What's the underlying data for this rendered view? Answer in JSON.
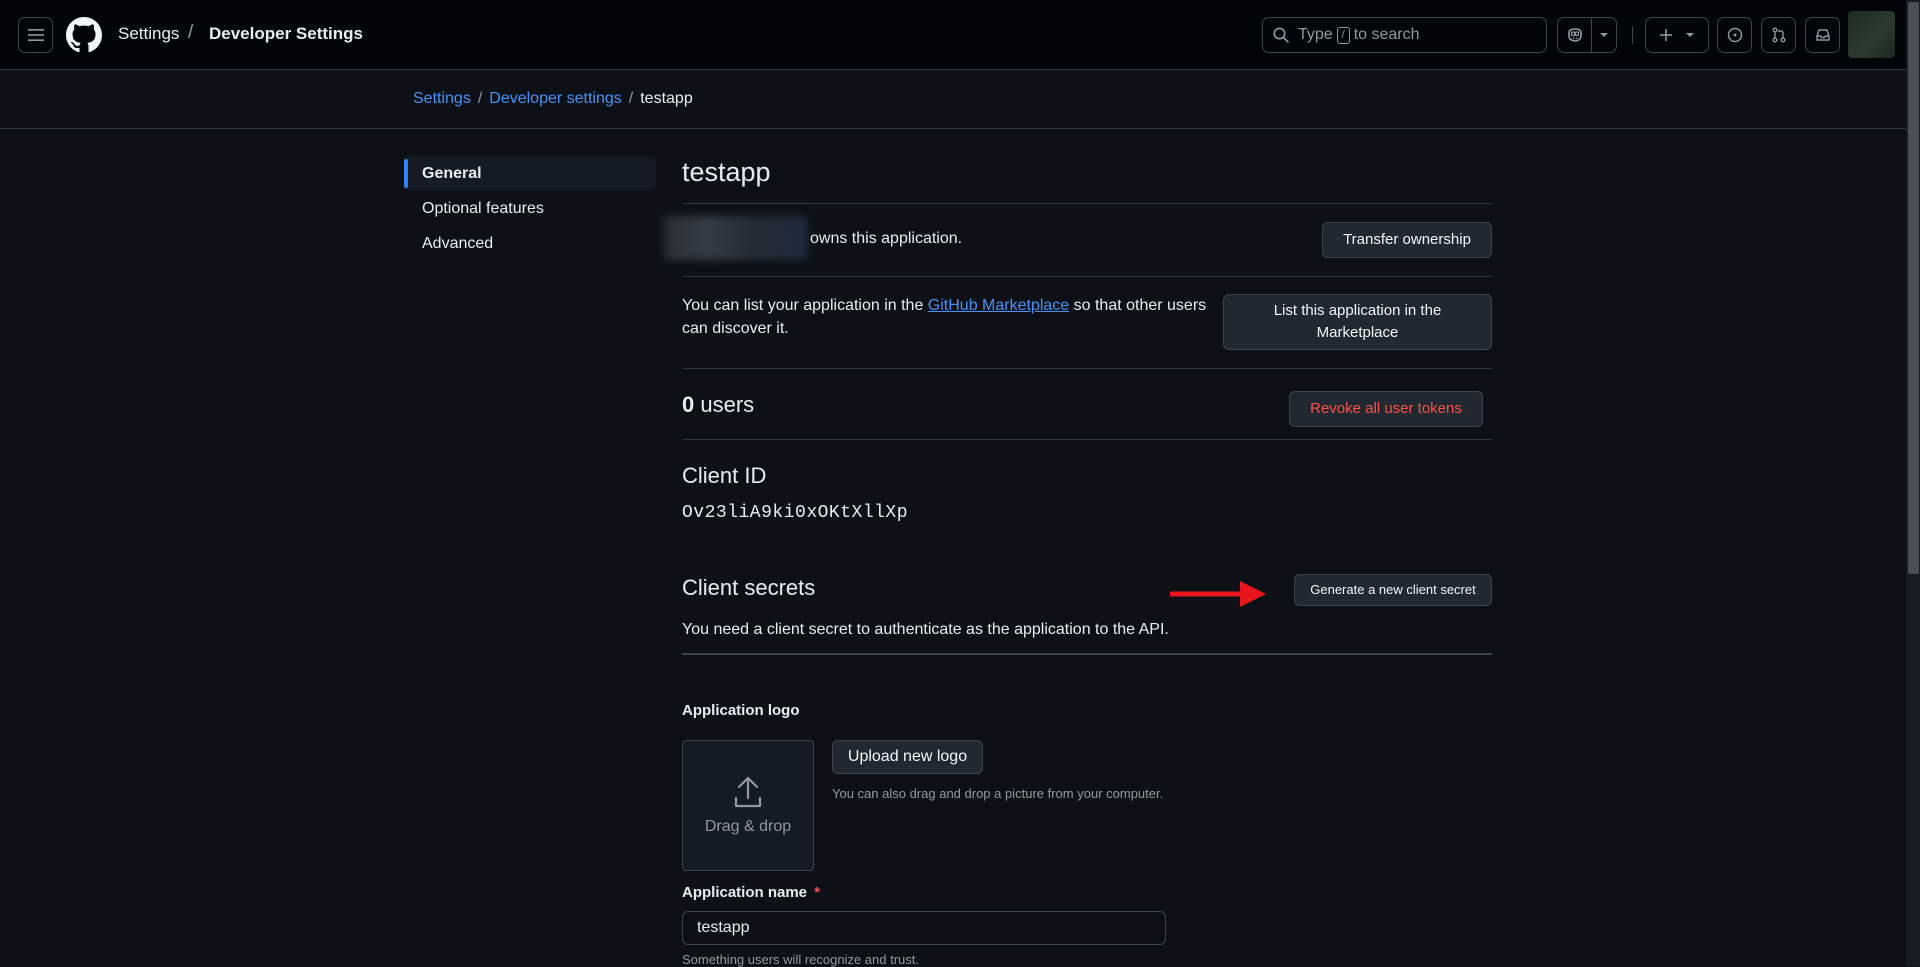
{
  "header": {
    "context_title": "Settings",
    "context_separator": "/",
    "context_subtitle": "Developer Settings",
    "search_prefix": "Type",
    "search_key": "/",
    "search_suffix": "to search",
    "icons": [
      "hamburger-icon",
      "github-logo",
      "search-icon",
      "copilot-icon",
      "chevron-down-icon",
      "plus-icon",
      "issues-icon",
      "pull-requests-icon",
      "inbox-icon"
    ]
  },
  "breadcrumb": {
    "items": [
      "Settings",
      "Developer settings",
      "testapp"
    ],
    "separator": "/"
  },
  "sidebar": {
    "items": [
      {
        "label": "General",
        "active": true
      },
      {
        "label": "Optional features",
        "active": false
      },
      {
        "label": "Advanced",
        "active": false
      }
    ]
  },
  "main": {
    "title": "testapp",
    "owner_text": "owns this application.",
    "transfer_label": "Transfer ownership",
    "marketplace_text_pre": "You can list your application in the",
    "marketplace_link": "GitHub Marketplace",
    "marketplace_text_post": "so that other users can discover it.",
    "marketplace_button": "List this application in the Marketplace",
    "users_count": "0",
    "users_label": "users",
    "revoke_label": "Revoke all user tokens",
    "client_id_heading": "Client ID",
    "client_id_value": "Ov23liA9ki0xOKtXllXp",
    "client_secrets_heading": "Client secrets",
    "generate_secret_label": "Generate a new client secret",
    "client_secret_text": "You need a client secret to authenticate as the application to the API.",
    "logo_heading": "Application logo",
    "drag_drop_label": "Drag & drop",
    "upload_logo_label": "Upload new logo",
    "upload_hint": "You can also drag and drop a picture from your computer.",
    "app_name_label": "Application name",
    "required_marker": "*",
    "app_name_value": "testapp",
    "app_name_hint": "Something users will recognize and trust."
  },
  "colors": {
    "background": "#0d1117",
    "header": "#010409",
    "link": "#4493f8",
    "danger": "#f85149",
    "accent": "#2f81f7",
    "annotation_arrow": "#e8161b"
  }
}
